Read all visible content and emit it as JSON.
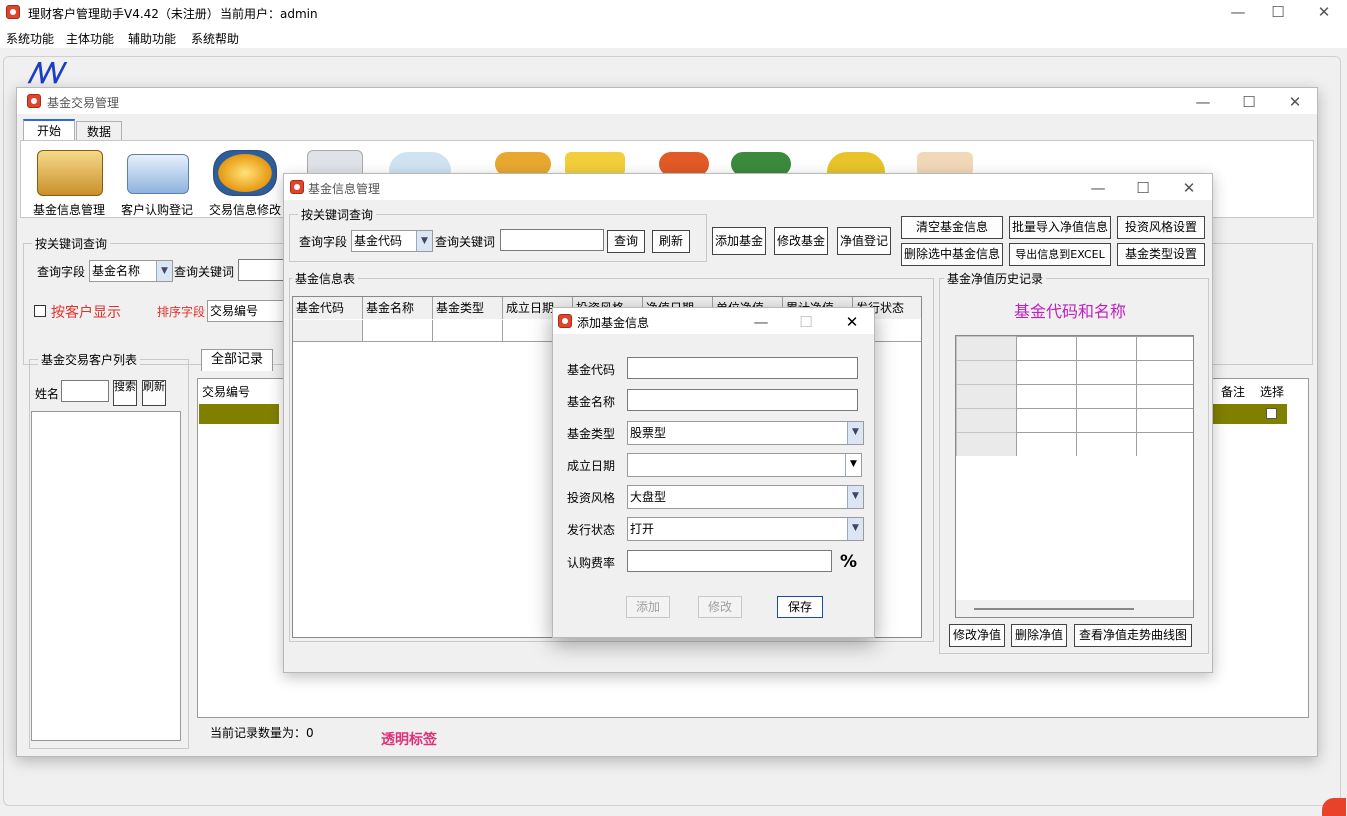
{
  "app": {
    "title": "理财客户管理助手V4.42（未注册）",
    "user_label": "当前用户：admin"
  },
  "menu": [
    "系统功能",
    "主体功能",
    "辅助功能",
    "系统帮助"
  ],
  "fund_trade_window": {
    "title": "基金交易管理",
    "ribbon_tabs": [
      "开始",
      "数据"
    ],
    "tools": [
      {
        "label": "基金信息管理",
        "icon": "chart-folder-icon"
      },
      {
        "label": "客户认购登记",
        "icon": "id-card-pen-icon"
      },
      {
        "label": "交易信息修改",
        "icon": "coins-hexagon-icon"
      }
    ],
    "query_group_label": "按关键词查询",
    "query_field_label": "查询字段",
    "query_field_value": "基金名称",
    "query_keyword_label": "查询关键词",
    "show_by_customer": "按客户显示",
    "sort_field_label": "排序字段",
    "sort_field_value": "交易编号",
    "customer_list_group": "基金交易客户列表",
    "name_label": "姓名",
    "search_button": "搜索",
    "refresh_button": "刷新",
    "records_tab": "全部记录",
    "table_headers": [
      "交易编号"
    ],
    "right_headers": [
      "备注",
      "选择"
    ],
    "record_count": "当前记录数量为：0",
    "transparent_label": "透明标签"
  },
  "fund_info_window": {
    "title": "基金信息管理",
    "query_group_label": "按关键词查询",
    "query_field_label": "查询字段",
    "query_field_value": "基金代码",
    "query_keyword_label": "查询关键词",
    "query_button": "查询",
    "refresh_button": "刷新",
    "actions": [
      "添加基金",
      "修改基金",
      "净值登记"
    ],
    "actions_grid": [
      "清空基金信息",
      "批量导入净值信息",
      "投资风格设置",
      "删除选中基金信息",
      "导出信息到EXCEL",
      "基金类型设置"
    ],
    "table_group_label": "基金信息表",
    "table_headers": [
      "基金代码",
      "基金名称",
      "基金类型",
      "成立日期",
      "投资风格",
      "净值日期",
      "单位净值",
      "累计净值",
      "发行状态"
    ],
    "history_group_label": "基金净值历史记录",
    "history_title": "基金代码和名称",
    "history_buttons": [
      "修改净值",
      "删除净值",
      "查看净值走势曲线图"
    ]
  },
  "add_fund_dialog": {
    "title": "添加基金信息",
    "fields": [
      {
        "label": "基金代码",
        "value": ""
      },
      {
        "label": "基金名称",
        "value": ""
      },
      {
        "label": "基金类型",
        "value": "股票型"
      },
      {
        "label": "成立日期",
        "value": ""
      },
      {
        "label": "投资风格",
        "value": "大盘型"
      },
      {
        "label": "发行状态",
        "value": "打开"
      },
      {
        "label": "认购费率",
        "value": ""
      }
    ],
    "percent_sign": "%",
    "add_button": "添加",
    "edit_button": "修改",
    "save_button": "保存"
  },
  "colors": {
    "selected_row": "#808000",
    "accent_red": "#e0312b",
    "purple_title": "#c020c0",
    "pink_label": "#e0307a"
  }
}
